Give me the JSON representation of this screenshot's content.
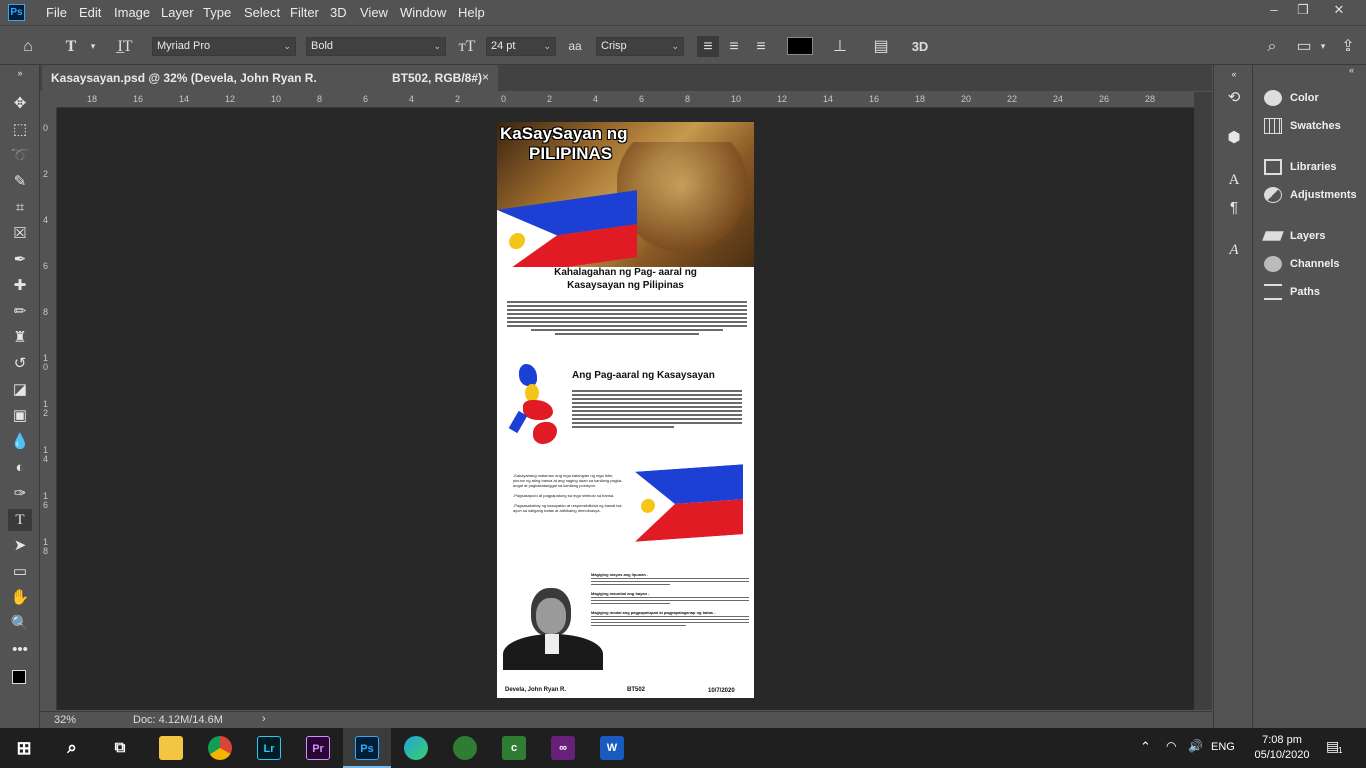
{
  "menubar": {
    "app_icon": "Ps",
    "items": [
      "File",
      "Edit",
      "Image",
      "Layer",
      "Type",
      "Select",
      "Filter",
      "3D",
      "View",
      "Window",
      "Help"
    ]
  },
  "options_bar": {
    "font_family": "Myriad Pro",
    "font_style": "Bold",
    "font_size": "24 pt",
    "antialias_icon": "aa",
    "antialias": "Crisp",
    "mode_3d": "3D",
    "text_color": "#000000"
  },
  "document_tab": {
    "title": "Kasaysayan.psd @ 32% (Devela, John Ryan R.",
    "subtitle": "BT502, RGB/8#)",
    "close": "×"
  },
  "ruler_top": [
    "18",
    "16",
    "14",
    "12",
    "10",
    "8",
    "6",
    "4",
    "2",
    "0",
    "2",
    "4",
    "6",
    "8",
    "10",
    "12",
    "14",
    "16",
    "18",
    "20",
    "22",
    "24",
    "26",
    "28"
  ],
  "ruler_left": [
    "0",
    "2",
    "4",
    "6",
    "8",
    "1 0",
    "1 2",
    "1 4",
    "1 6",
    "1 8"
  ],
  "status": {
    "zoom": "32%",
    "doc": "Doc: 4.12M/14.6M",
    "arrow": "›"
  },
  "panels": [
    {
      "label": "Color",
      "icon": "palette-icon"
    },
    {
      "label": "Swatches",
      "icon": "swatches-grid-icon"
    },
    {
      "label": "Libraries",
      "icon": "libraries-icon"
    },
    {
      "label": "Adjustments",
      "icon": "adjustments-icon"
    },
    {
      "label": "Layers",
      "icon": "layers-icon"
    },
    {
      "label": "Channels",
      "icon": "channels-icon"
    },
    {
      "label": "Paths",
      "icon": "paths-icon"
    }
  ],
  "document": {
    "banner_title_1": "KaSaySayan ng",
    "banner_title_2": "PILIPINAS",
    "heading1_line1": "Kahalagahan ng Pag- aaral ng",
    "heading1_line2": "Kasaysayan ng Pilipinas",
    "heading2": "Ang Pag-aaral ng Kasaysayan",
    "bullets": [
      "-Kakayahang malaman ang mga katangian ng mga lider, pinuno ng ating bansa at ang naging daan sa kanilang pagka- angat at pagkakatanggal sa kanilang posisyon.",
      "-Pagsasaputo at pagpapatung sa mga simbolo sa bansa.",
      "-Pagsasakahay ng kasapatan at responsibilidad ng bawat isa ayon sa saligang batas at adhikaing demokrasya."
    ],
    "list_heads": [
      "Magiging mayos ang lipunan -",
      "Magiging maunlad ang bayan -",
      "Magiging modal ang pagpapatupad at pagpapalaganap ng batas -"
    ],
    "footer_name": "Devela, John Ryan R.",
    "footer_code": "BT502",
    "footer_date": "10/7/2020"
  },
  "taskbar": {
    "time": "7:08 pm",
    "date": "05/10/2020",
    "lang": "ENG",
    "notification_count": "1",
    "apps": [
      "Lr",
      "Pr",
      "Ps"
    ]
  },
  "colors": {
    "ps_blue": "#31a8ff",
    "panel_bg": "#535353",
    "canvas_bg": "#282828",
    "taskbar_bg": "#1f1f1f",
    "flag_blue": "#1c3fd4",
    "flag_red": "#e01b24"
  }
}
